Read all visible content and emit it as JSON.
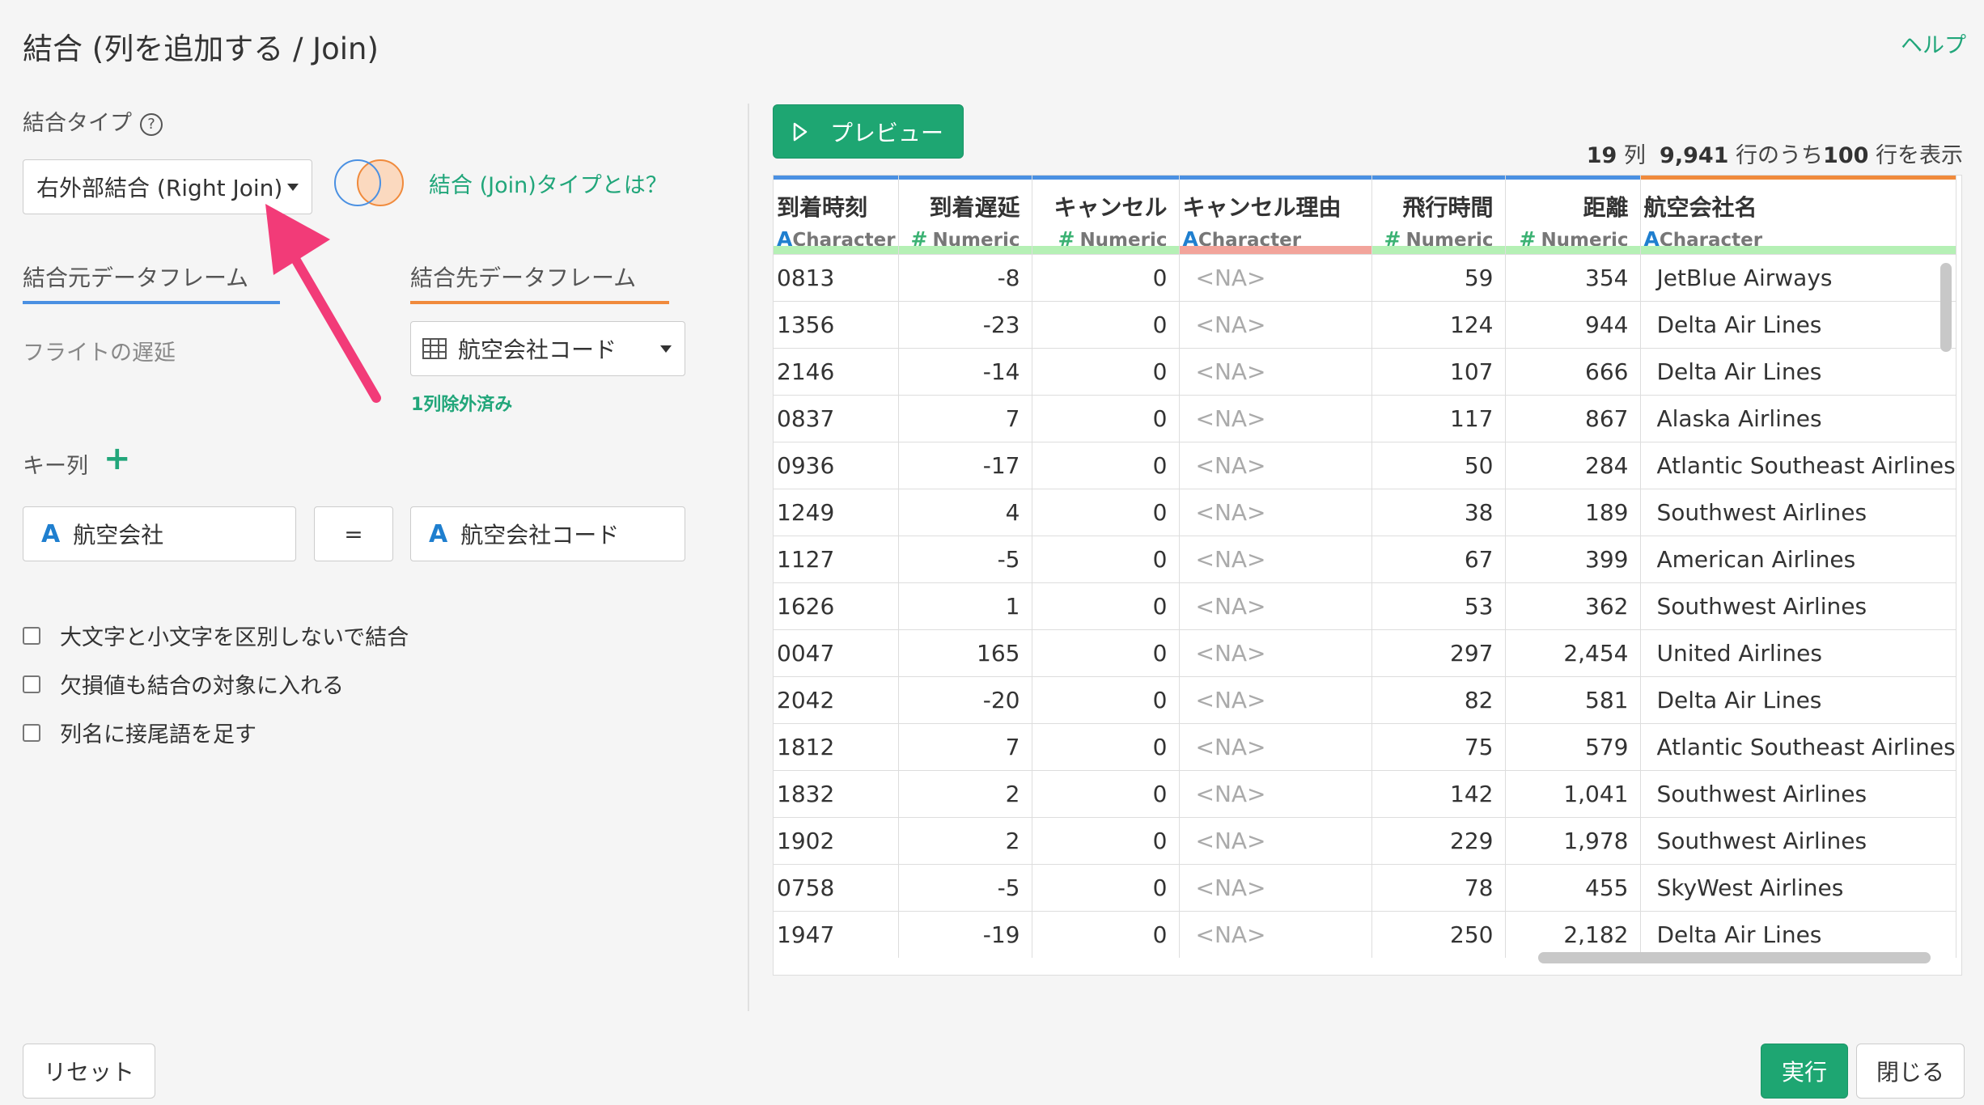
{
  "dialog": {
    "title": "結合 (列を追加する / Join)",
    "help_label": "ヘルプ"
  },
  "join_type": {
    "label": "結合タイプ",
    "help_icon": "question-circle-icon",
    "selected": "右外部結合 (Right Join)",
    "info_link": "結合 (Join)タイプとは？"
  },
  "source_tab": {
    "label": "結合元データフレーム",
    "value": "フライトの遅延",
    "underline_color": "#4a90e2"
  },
  "target_tab": {
    "label": "結合先データフレーム",
    "selected": "航空会社コード",
    "excluded_note": "1列除外済み",
    "underline_color": "#f08a3c"
  },
  "key_columns": {
    "label": "キー列",
    "add_icon": "plus-icon",
    "left": "航空会社",
    "operator": "=",
    "right": "航空会社コード"
  },
  "options": [
    {
      "label": "大文字と小文字を区別しないで結合",
      "checked": false
    },
    {
      "label": "欠損値も結合の対象に入れる",
      "checked": false
    },
    {
      "label": "列名に接尾語を足す",
      "checked": false
    }
  ],
  "buttons": {
    "reset": "リセット",
    "run": "実行",
    "close": "閉じる"
  },
  "preview": {
    "button_label": "プレビュー",
    "summary": {
      "cols": "19",
      "cols_unit": "列",
      "rows_total": "9,941",
      "rows_mid": "行のうち",
      "rows_shown": "100",
      "rows_tail": "行を表示"
    },
    "columns": [
      {
        "name": "到着時刻",
        "type_icon": "A",
        "type": "Character",
        "align": "left",
        "top_color": "#4a90e2",
        "bottom_color": "#b5f0b5"
      },
      {
        "name": "到着遅延",
        "type_icon": "#",
        "type": "Numeric",
        "align": "right",
        "top_color": "#4a90e2",
        "bottom_color": "#b5f0b5"
      },
      {
        "name": "キャンセル",
        "type_icon": "#",
        "type": "Numeric",
        "align": "right",
        "top_color": "#4a90e2",
        "bottom_color": "#b5f0b5"
      },
      {
        "name": "キャンセル理由",
        "type_icon": "A",
        "type": "Character",
        "align": "left",
        "top_color": "#4a90e2",
        "bottom_color": "#f2a49b"
      },
      {
        "name": "飛行時間",
        "type_icon": "#",
        "type": "Numeric",
        "align": "right",
        "top_color": "#4a90e2",
        "bottom_color": "#b5f0b5"
      },
      {
        "name": "距離",
        "type_icon": "#",
        "type": "Numeric",
        "align": "right",
        "top_color": "#4a90e2",
        "bottom_color": "#b5f0b5"
      },
      {
        "name": "航空会社名",
        "type_icon": "A",
        "type": "Character",
        "align": "left",
        "top_color": "#f08a3c",
        "bottom_color": "#b5f0b5"
      }
    ],
    "rows": [
      [
        "0813",
        "-8",
        "0",
        "<NA>",
        "59",
        "354",
        "JetBlue Airways"
      ],
      [
        "1356",
        "-23",
        "0",
        "<NA>",
        "124",
        "944",
        "Delta Air Lines"
      ],
      [
        "2146",
        "-14",
        "0",
        "<NA>",
        "107",
        "666",
        "Delta Air Lines"
      ],
      [
        "0837",
        "7",
        "0",
        "<NA>",
        "117",
        "867",
        "Alaska Airlines"
      ],
      [
        "0936",
        "-17",
        "0",
        "<NA>",
        "50",
        "284",
        "Atlantic Southeast Airlines"
      ],
      [
        "1249",
        "4",
        "0",
        "<NA>",
        "38",
        "189",
        "Southwest Airlines"
      ],
      [
        "1127",
        "-5",
        "0",
        "<NA>",
        "67",
        "399",
        "American Airlines"
      ],
      [
        "1626",
        "1",
        "0",
        "<NA>",
        "53",
        "362",
        "Southwest Airlines"
      ],
      [
        "0047",
        "165",
        "0",
        "<NA>",
        "297",
        "2,454",
        "United Airlines"
      ],
      [
        "2042",
        "-20",
        "0",
        "<NA>",
        "82",
        "581",
        "Delta Air Lines"
      ],
      [
        "1812",
        "7",
        "0",
        "<NA>",
        "75",
        "579",
        "Atlantic Southeast Airlines"
      ],
      [
        "1832",
        "2",
        "0",
        "<NA>",
        "142",
        "1,041",
        "Southwest Airlines"
      ],
      [
        "1902",
        "2",
        "0",
        "<NA>",
        "229",
        "1,978",
        "Southwest Airlines"
      ],
      [
        "0758",
        "-5",
        "0",
        "<NA>",
        "78",
        "455",
        "SkyWest Airlines"
      ],
      [
        "1947",
        "-19",
        "0",
        "<NA>",
        "250",
        "2,182",
        "Delta Air Lines"
      ]
    ]
  },
  "colors": {
    "accent_green": "#21a67a",
    "arrow_pink": "#f23b78"
  }
}
